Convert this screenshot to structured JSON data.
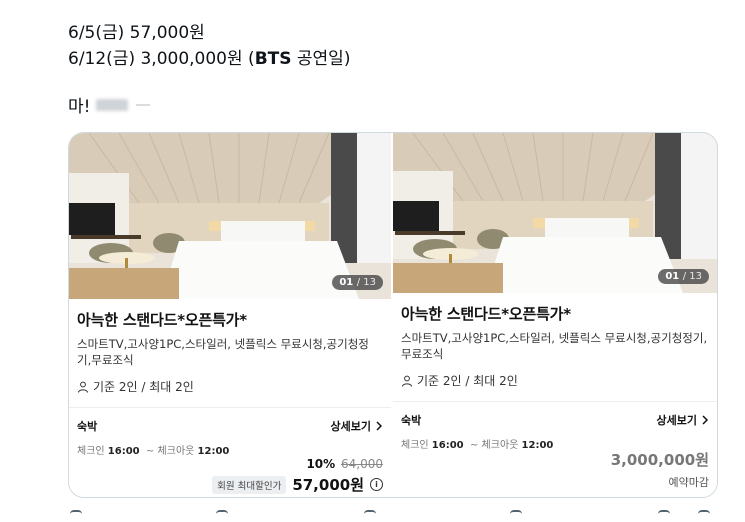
{
  "tweet": {
    "line1": "6/5(금) 57,000원",
    "line2_prefix": "6/12(금) 3,000,000원 (",
    "line2_bold": "BTS",
    "line2_suffix": " 공연일)",
    "line3": "마!"
  },
  "cards": [
    {
      "counter_current": "01",
      "counter_total": "/ 13",
      "title": "아늑한 스탠다드*오픈특가*",
      "description": "스마트TV,고사양1PC,스타일러, 넷플릭스 무료시청,공기청정기,무료조식",
      "capacity": "기준 2인 / 최대 2인",
      "stay_label": "숙박",
      "detail_label": "상세보기",
      "checkin_label": "체크인",
      "checkin_time": "16:00",
      "checkout_label": "~ 체크아웃",
      "checkout_time": "12:00",
      "discount_pct": "10%",
      "original_price": "64,000",
      "member_badge": "회원 최대할인가",
      "final_price": "57,000원"
    },
    {
      "counter_current": "01",
      "counter_total": "/ 13",
      "title": "아늑한 스탠다드*오픈특가*",
      "description": "스마트TV,고사양1PC,스타일러, 넷플릭스 무료시청,공기청정기,무료조식",
      "capacity": "기준 2인 / 최대 2인",
      "stay_label": "숙박",
      "detail_label": "상세보기",
      "checkin_label": "체크인",
      "checkin_time": "16:00",
      "checkout_label": "~ 체크아웃",
      "checkout_time": "12:00",
      "price": "3,000,000원",
      "status": "예약마감"
    }
  ],
  "icons": {
    "person": "person-icon",
    "chevron": "chevron-right-icon",
    "info": "info-icon"
  }
}
